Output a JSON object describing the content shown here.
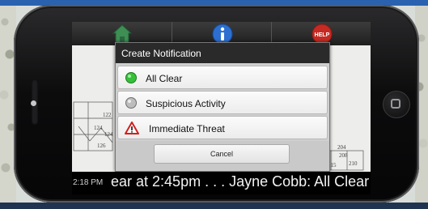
{
  "dialog": {
    "title": "Create Notification",
    "options": [
      {
        "label": "All Clear",
        "icon": "green-circle-icon"
      },
      {
        "label": "Suspicious Activity",
        "icon": "gray-circle-icon"
      },
      {
        "label": "Immediate Threat",
        "icon": "warning-triangle-icon"
      }
    ],
    "cancel_label": "Cancel"
  },
  "tabs": [
    {
      "icon": "home-icon"
    },
    {
      "icon": "info-icon"
    },
    {
      "icon": "help-icon",
      "label": "HELP"
    }
  ],
  "map": {
    "room_labels": [
      "122",
      "124",
      "124",
      "126",
      "204",
      "208",
      "210",
      "215"
    ]
  },
  "ticker": {
    "time": "2:18 PM",
    "text": "ear at 2:45pm . . . Jayne Cobb: All Clear"
  },
  "colors": {
    "all_clear": "#35c03a",
    "threat": "#d41f1f",
    "help_red": "#c62a23",
    "info_blue": "#2d6fd1",
    "home_green": "#3f8f55"
  }
}
